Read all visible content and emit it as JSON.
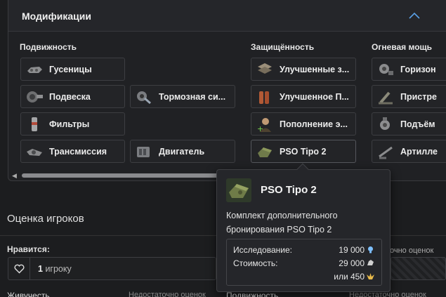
{
  "modifications": {
    "title": "Модификации",
    "columns": [
      {
        "title": "Подвижность"
      },
      {
        "title": "Защищённость"
      },
      {
        "title": "Огневая мощь"
      }
    ],
    "mobility": {
      "tracks": "Гусеницы",
      "suspension": "Подвеска",
      "brakes": "Тормозная си...",
      "filters": "Фильтры",
      "transmission": "Трансмиссия",
      "engine": "Двигатель"
    },
    "protection": {
      "improved_z": "Улучшенные з...",
      "improved_p": "Улучшенное П...",
      "replenish": "Пополнение э...",
      "pso": "PSO Tipo 2"
    },
    "firepower": {
      "horizontal": "Горизон",
      "adjust": "Пристре",
      "lift": "Подъём",
      "artillery": "Артилле"
    }
  },
  "ratings": {
    "title": "Оценка игроков",
    "likes_label": "Нравится:",
    "like_count": "1",
    "like_unit": "игроку",
    "right_note": "очно оценок",
    "row_left_a": "Живучесть",
    "row_left_b": "Недостаточно оценок",
    "row_right_a": "Подвижность",
    "row_right_b": "Недостаточно оценок"
  },
  "tooltip": {
    "title": "PSO Tipo 2",
    "description": "Комплект дополнительного бронирования PSO Tipo 2",
    "research_label": "Исследование:",
    "research_value": "19 000",
    "cost_label": "Стоимость:",
    "cost_value": "29 000",
    "alt_cost": "или 450"
  },
  "icons": {
    "collapse": "chevron-up-icon",
    "research": "research-point-icon",
    "silver": "silver-lion-icon",
    "gold": "golden-eagle-icon"
  },
  "colors": {
    "accent": "#5aa0e6",
    "research": "#7ec0ff",
    "silver": "#cfcfcf",
    "gold": "#e7b94a"
  }
}
